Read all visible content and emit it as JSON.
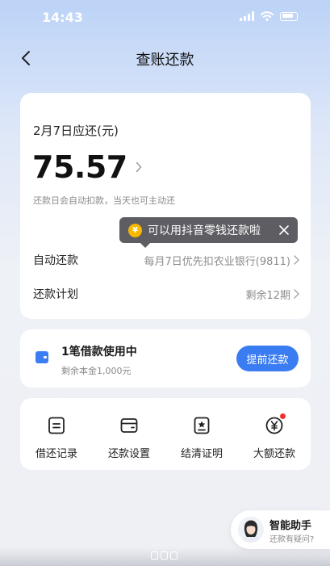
{
  "status_bar": {
    "time": "14:43"
  },
  "nav": {
    "title": "查账还款"
  },
  "bill": {
    "due_label": "2月7日应还(元)",
    "amount": "75.57",
    "note": "还款日会自动扣款，当天也可主动还"
  },
  "tooltip": {
    "text": "可以用抖音零钱还款啦",
    "coin_symbol": "¥"
  },
  "rows": {
    "auto_repay": {
      "label": "自动还款",
      "value": "每月7日优先扣农业银行(9811)"
    },
    "plan": {
      "label": "还款计划",
      "value": "剩余12期"
    }
  },
  "loan": {
    "title": "1笔借款使用中",
    "subtitle": "剩余本金1,000元",
    "button": "提前还款"
  },
  "shortcuts": [
    {
      "label": "借还记录",
      "icon": "record-icon"
    },
    {
      "label": "还款设置",
      "icon": "wallet-icon"
    },
    {
      "label": "结清证明",
      "icon": "certificate-icon"
    },
    {
      "label": "大额还款",
      "icon": "yuan-coin-icon",
      "badge": true
    }
  ],
  "assistant": {
    "title": "智能助手",
    "subtitle": "还款有疑问?"
  },
  "colors": {
    "accent": "#3a7cf2",
    "coin": "#f6b800",
    "badge": "#f23030"
  }
}
